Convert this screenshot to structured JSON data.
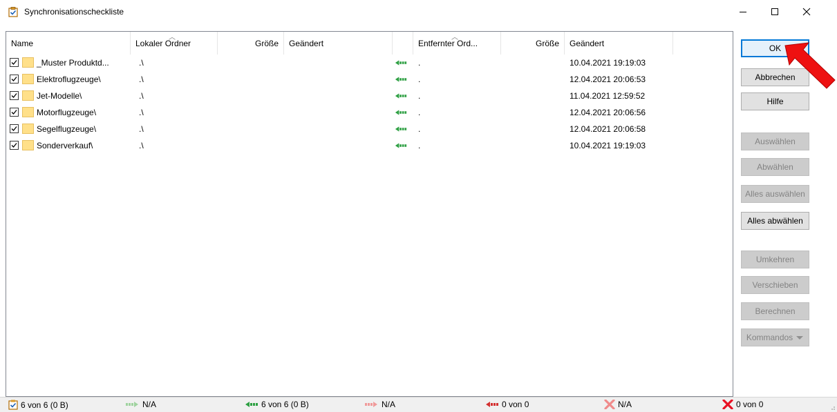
{
  "window": {
    "title": "Synchronisationscheckliste",
    "controls": {
      "minimize": "minimize-icon",
      "maximize": "maximize-icon",
      "close": "close-icon"
    }
  },
  "columns": {
    "name": "Name",
    "local_folder": "Lokaler Ordner",
    "local_size": "Größe",
    "local_changed": "Geändert",
    "remote_folder": "Entfernter Ord...",
    "remote_size": "Größe",
    "remote_changed": "Geändert"
  },
  "rows": [
    {
      "name": "_Muster Produktd...",
      "local": ".\\",
      "remote": ".",
      "changed": "10.04.2021 19:19:03",
      "checked": true
    },
    {
      "name": "Elektroflugzeuge\\",
      "local": ".\\",
      "remote": ".",
      "changed": "12.04.2021 20:06:53",
      "checked": true
    },
    {
      "name": "Jet-Modelle\\",
      "local": ".\\",
      "remote": ".",
      "changed": "11.04.2021 12:59:52",
      "checked": true
    },
    {
      "name": "Motorflugzeuge\\",
      "local": ".\\",
      "remote": ".",
      "changed": "12.04.2021 20:06:56",
      "checked": true
    },
    {
      "name": "Segelflugzeuge\\",
      "local": ".\\",
      "remote": ".",
      "changed": "12.04.2021 20:06:58",
      "checked": true
    },
    {
      "name": "Sonderverkauf\\",
      "local": ".\\",
      "remote": ".",
      "changed": "10.04.2021 19:19:03",
      "checked": true
    }
  ],
  "buttons": {
    "ok": "OK",
    "cancel": "Abbrechen",
    "help": "Hilfe",
    "select": "Auswählen",
    "deselect": "Abwählen",
    "select_all": "Alles auswählen",
    "deselect_all": "Alles abwählen",
    "invert": "Umkehren",
    "move": "Verschieben",
    "calculate": "Berechnen",
    "commands": "Kommandos"
  },
  "status": {
    "total": "6 von 6 (0 B)",
    "upload": "N/A",
    "download": "6 von 6 (0 B)",
    "local_delete": "N/A",
    "remote_delete": "0 von 0",
    "conflict": "N/A",
    "errors": "0 von 0"
  },
  "colors": {
    "accent": "#0078d7",
    "download_arrow": "#2ea043",
    "delete_red": "#e81123",
    "folder_yellow": "#ffd866"
  }
}
